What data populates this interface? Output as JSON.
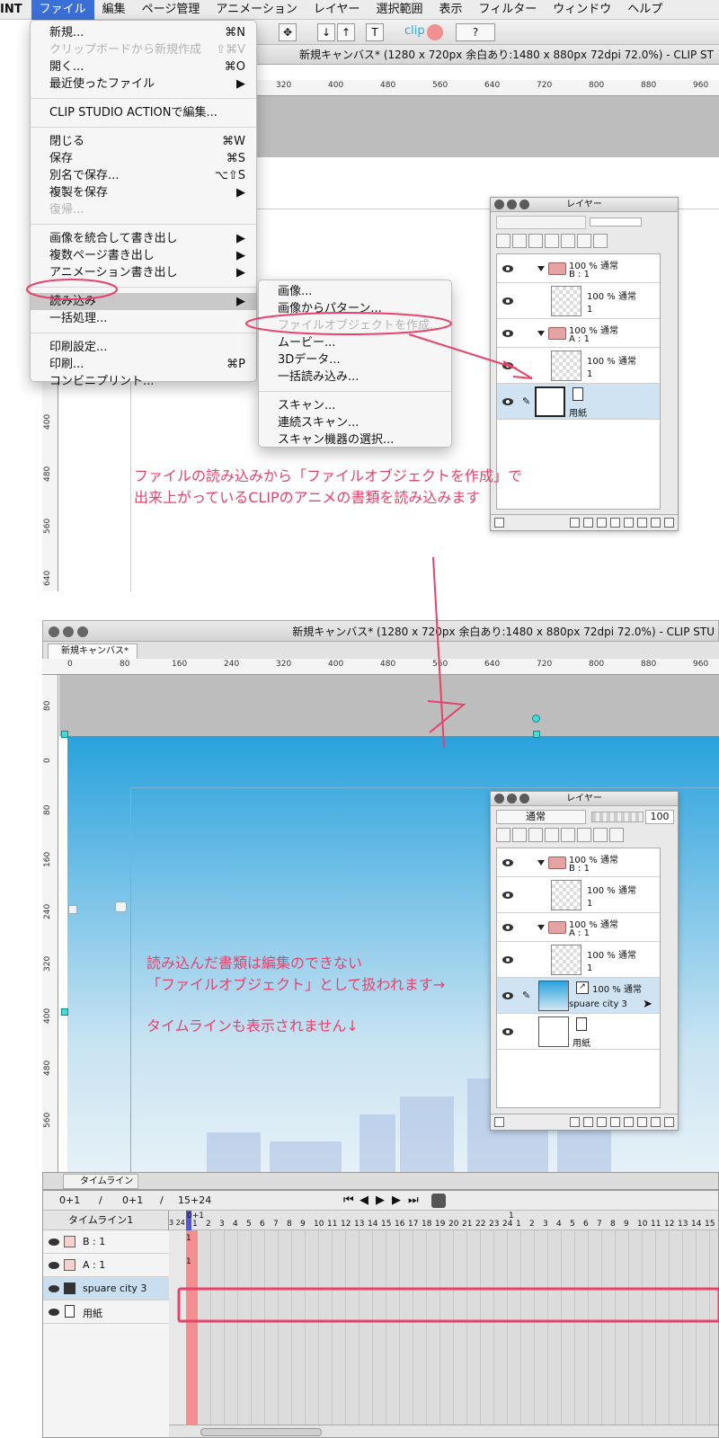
{
  "menubar": {
    "app_label": "INT",
    "items": [
      "ファイル",
      "編集",
      "ページ管理",
      "アニメーション",
      "レイヤー",
      "選択範囲",
      "表示",
      "フィルター",
      "ウィンドウ",
      "ヘルプ"
    ]
  },
  "window1": {
    "title": "新規キャンバス* (1280 x 720px 余白あり:1480 x 880px 72dpi 72.0%)  - CLIP ST",
    "ruler_top": [
      "320",
      "400",
      "480",
      "560",
      "640",
      "720",
      "800",
      "880",
      "960"
    ],
    "ruler_left": [
      "400",
      "480",
      "560",
      "640"
    ]
  },
  "file_menu": {
    "items": [
      {
        "label": "新規...",
        "shortcut": "⌘N",
        "disabled": false
      },
      {
        "label": "クリップボードから新規作成",
        "shortcut": "⇧⌘V",
        "disabled": true
      },
      {
        "label": "開く...",
        "shortcut": "⌘O",
        "disabled": false
      },
      {
        "label": "最近使ったファイル",
        "shortcut": "▶",
        "disabled": false
      },
      {
        "label": "CLIP STUDIO ACTIONで編集...",
        "shortcut": "",
        "disabled": false
      },
      {
        "label": "閉じる",
        "shortcut": "⌘W",
        "disabled": false
      },
      {
        "label": "保存",
        "shortcut": "⌘S",
        "disabled": false
      },
      {
        "label": "別名で保存...",
        "shortcut": "⌥⇧S",
        "disabled": false
      },
      {
        "label": "複製を保存",
        "shortcut": "▶",
        "disabled": false
      },
      {
        "label": "復帰...",
        "shortcut": "",
        "disabled": true
      },
      {
        "label": "画像を統合して書き出し",
        "shortcut": "▶",
        "disabled": false
      },
      {
        "label": "複数ページ書き出し",
        "shortcut": "▶",
        "disabled": false
      },
      {
        "label": "アニメーション書き出し",
        "shortcut": "▶",
        "disabled": false
      },
      {
        "label": "読み込み",
        "shortcut": "▶",
        "disabled": false
      },
      {
        "label": "一括処理...",
        "shortcut": "",
        "disabled": false
      },
      {
        "label": "印刷設定...",
        "shortcut": "",
        "disabled": false
      },
      {
        "label": "印刷...",
        "shortcut": "⌘P",
        "disabled": false
      },
      {
        "label": "コンビニプリント...",
        "shortcut": "",
        "disabled": false
      }
    ]
  },
  "import_submenu": {
    "items": [
      {
        "label": "画像...",
        "disabled": false
      },
      {
        "label": "画像からパターン...",
        "disabled": false
      },
      {
        "label": "ファイルオブジェクトを作成...",
        "disabled": true
      },
      {
        "label": "ムービー...",
        "disabled": false
      },
      {
        "label": "3Dデータ...",
        "disabled": false
      },
      {
        "label": "一括読み込み...",
        "disabled": false
      },
      {
        "label": "スキャン...",
        "disabled": false
      },
      {
        "label": "連続スキャン...",
        "disabled": false
      },
      {
        "label": "スキャン機器の選択...",
        "disabled": false
      }
    ]
  },
  "layer_panel1": {
    "title": "レイヤー",
    "rows": [
      {
        "line1": "100 % 通常",
        "line2": "B : 1"
      },
      {
        "line1": "100 % 通常",
        "line2": "1"
      },
      {
        "line1": "100 % 通常",
        "line2": "A : 1"
      },
      {
        "line1": "100 % 通常",
        "line2": "1"
      },
      {
        "line1": "",
        "line2": "用紙"
      }
    ]
  },
  "annotation1": {
    "line1": "ファイルの読み込みから「ファイルオブジェクトを作成」で",
    "line2": "出来上がっているCLIPのアニメの書類を読み込みます"
  },
  "window2": {
    "title": "新規キャンバス* (1280 x 720px 余白あり:1480 x 880px 72dpi 72.0%)  - CLIP STU",
    "tab": "新規キャンバス*",
    "ruler_top": [
      "0",
      "80",
      "160",
      "240",
      "320",
      "400",
      "480",
      "560",
      "640",
      "720",
      "800",
      "880",
      "960"
    ],
    "ruler_left": [
      "80",
      "0",
      "80",
      "160",
      "240",
      "320",
      "400",
      "480",
      "560"
    ]
  },
  "layer_panel2": {
    "title": "レイヤー",
    "blend_mode": "通常",
    "opacity": "100",
    "rows": [
      {
        "line1": "100 % 通常",
        "line2": "B : 1"
      },
      {
        "line1": "100 % 通常",
        "line2": "1"
      },
      {
        "line1": "100 % 通常",
        "line2": "A : 1"
      },
      {
        "line1": "100 % 通常",
        "line2": "1"
      },
      {
        "line1": "100 % 通常",
        "line2": "spuare city 3"
      },
      {
        "line1": "",
        "line2": "用紙"
      }
    ]
  },
  "annotation2": {
    "line1": "読み込んだ書類は編集のできない",
    "line2": "「ファイルオブジェクト」として扱われます→",
    "line3": "タイムラインも表示されません↓"
  },
  "timeline": {
    "tab_label": "タイムライン",
    "frame_a": "0+1",
    "sep1": "/",
    "frame_b": "0+1",
    "sep2": "/",
    "frame_c": "15+24",
    "name": "タイムライン1",
    "marker_0": "0+1",
    "marker_1": "1",
    "start_frames": "3 24",
    "frames": [
      "1",
      "2",
      "3",
      "4",
      "5",
      "6",
      "7",
      "8",
      "9",
      "10",
      "11",
      "12",
      "13",
      "14",
      "15",
      "16",
      "17",
      "18",
      "19",
      "20",
      "21",
      "22",
      "23",
      "24",
      "1",
      "2",
      "3",
      "4",
      "5",
      "6",
      "7",
      "8",
      "9",
      "10",
      "11",
      "12",
      "13",
      "14",
      "15",
      "1"
    ],
    "tracks": [
      {
        "name": "B : 1",
        "cell": "1"
      },
      {
        "name": "A : 1",
        "cell": "1"
      },
      {
        "name": "spuare city 3",
        "cell": ""
      },
      {
        "name": "用紙",
        "cell": ""
      }
    ]
  },
  "colors": {
    "accent_red": "#e8426b",
    "sky_top": "#2aa3dc",
    "sky_bottom": "#cfe6f3",
    "menu_highlight": "#3b6fd8"
  }
}
